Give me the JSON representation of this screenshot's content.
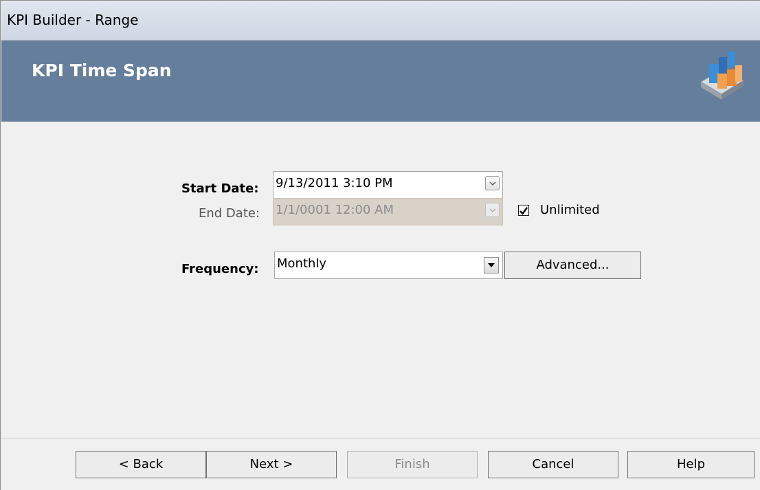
{
  "window": {
    "title": "KPI Builder - Range"
  },
  "header": {
    "title": "KPI Time Span",
    "icon": "kpi-chart-icon"
  },
  "form": {
    "start_date": {
      "label": "Start Date:",
      "value": "9/13/2011 3:10 PM"
    },
    "end_date": {
      "label": "End Date:",
      "value": "1/1/0001 12:00 AM",
      "disabled": true
    },
    "unlimited": {
      "label": "Unlimited",
      "checked": true
    },
    "frequency": {
      "label": "Frequency:",
      "value": "Monthly"
    },
    "advanced_label": "Advanced..."
  },
  "footer": {
    "back_label": "< Back",
    "next_label": "Next >",
    "finish_label": "Finish",
    "cancel_label": "Cancel",
    "help_label": "Help"
  },
  "colors": {
    "banner": "#657e9b",
    "titlebar": "#dfe6ef",
    "panel": "#f0f0f0"
  }
}
